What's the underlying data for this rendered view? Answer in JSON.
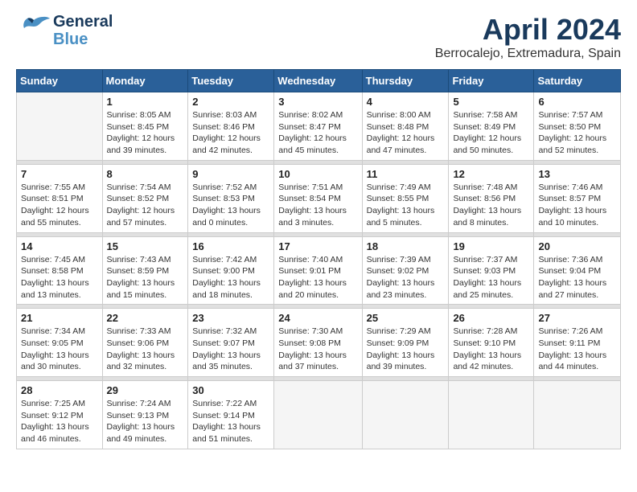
{
  "header": {
    "logo_general": "General",
    "logo_blue": "Blue",
    "month_title": "April 2024",
    "location": "Berrocalejo, Extremadura, Spain"
  },
  "columns": [
    "Sunday",
    "Monday",
    "Tuesday",
    "Wednesday",
    "Thursday",
    "Friday",
    "Saturday"
  ],
  "weeks": [
    {
      "days": [
        {
          "number": "",
          "empty": true
        },
        {
          "number": "1",
          "sunrise": "Sunrise: 8:05 AM",
          "sunset": "Sunset: 8:45 PM",
          "daylight": "Daylight: 12 hours and 39 minutes."
        },
        {
          "number": "2",
          "sunrise": "Sunrise: 8:03 AM",
          "sunset": "Sunset: 8:46 PM",
          "daylight": "Daylight: 12 hours and 42 minutes."
        },
        {
          "number": "3",
          "sunrise": "Sunrise: 8:02 AM",
          "sunset": "Sunset: 8:47 PM",
          "daylight": "Daylight: 12 hours and 45 minutes."
        },
        {
          "number": "4",
          "sunrise": "Sunrise: 8:00 AM",
          "sunset": "Sunset: 8:48 PM",
          "daylight": "Daylight: 12 hours and 47 minutes."
        },
        {
          "number": "5",
          "sunrise": "Sunrise: 7:58 AM",
          "sunset": "Sunset: 8:49 PM",
          "daylight": "Daylight: 12 hours and 50 minutes."
        },
        {
          "number": "6",
          "sunrise": "Sunrise: 7:57 AM",
          "sunset": "Sunset: 8:50 PM",
          "daylight": "Daylight: 12 hours and 52 minutes."
        }
      ]
    },
    {
      "days": [
        {
          "number": "7",
          "sunrise": "Sunrise: 7:55 AM",
          "sunset": "Sunset: 8:51 PM",
          "daylight": "Daylight: 12 hours and 55 minutes."
        },
        {
          "number": "8",
          "sunrise": "Sunrise: 7:54 AM",
          "sunset": "Sunset: 8:52 PM",
          "daylight": "Daylight: 12 hours and 57 minutes."
        },
        {
          "number": "9",
          "sunrise": "Sunrise: 7:52 AM",
          "sunset": "Sunset: 8:53 PM",
          "daylight": "Daylight: 13 hours and 0 minutes."
        },
        {
          "number": "10",
          "sunrise": "Sunrise: 7:51 AM",
          "sunset": "Sunset: 8:54 PM",
          "daylight": "Daylight: 13 hours and 3 minutes."
        },
        {
          "number": "11",
          "sunrise": "Sunrise: 7:49 AM",
          "sunset": "Sunset: 8:55 PM",
          "daylight": "Daylight: 13 hours and 5 minutes."
        },
        {
          "number": "12",
          "sunrise": "Sunrise: 7:48 AM",
          "sunset": "Sunset: 8:56 PM",
          "daylight": "Daylight: 13 hours and 8 minutes."
        },
        {
          "number": "13",
          "sunrise": "Sunrise: 7:46 AM",
          "sunset": "Sunset: 8:57 PM",
          "daylight": "Daylight: 13 hours and 10 minutes."
        }
      ]
    },
    {
      "days": [
        {
          "number": "14",
          "sunrise": "Sunrise: 7:45 AM",
          "sunset": "Sunset: 8:58 PM",
          "daylight": "Daylight: 13 hours and 13 minutes."
        },
        {
          "number": "15",
          "sunrise": "Sunrise: 7:43 AM",
          "sunset": "Sunset: 8:59 PM",
          "daylight": "Daylight: 13 hours and 15 minutes."
        },
        {
          "number": "16",
          "sunrise": "Sunrise: 7:42 AM",
          "sunset": "Sunset: 9:00 PM",
          "daylight": "Daylight: 13 hours and 18 minutes."
        },
        {
          "number": "17",
          "sunrise": "Sunrise: 7:40 AM",
          "sunset": "Sunset: 9:01 PM",
          "daylight": "Daylight: 13 hours and 20 minutes."
        },
        {
          "number": "18",
          "sunrise": "Sunrise: 7:39 AM",
          "sunset": "Sunset: 9:02 PM",
          "daylight": "Daylight: 13 hours and 23 minutes."
        },
        {
          "number": "19",
          "sunrise": "Sunrise: 7:37 AM",
          "sunset": "Sunset: 9:03 PM",
          "daylight": "Daylight: 13 hours and 25 minutes."
        },
        {
          "number": "20",
          "sunrise": "Sunrise: 7:36 AM",
          "sunset": "Sunset: 9:04 PM",
          "daylight": "Daylight: 13 hours and 27 minutes."
        }
      ]
    },
    {
      "days": [
        {
          "number": "21",
          "sunrise": "Sunrise: 7:34 AM",
          "sunset": "Sunset: 9:05 PM",
          "daylight": "Daylight: 13 hours and 30 minutes."
        },
        {
          "number": "22",
          "sunrise": "Sunrise: 7:33 AM",
          "sunset": "Sunset: 9:06 PM",
          "daylight": "Daylight: 13 hours and 32 minutes."
        },
        {
          "number": "23",
          "sunrise": "Sunrise: 7:32 AM",
          "sunset": "Sunset: 9:07 PM",
          "daylight": "Daylight: 13 hours and 35 minutes."
        },
        {
          "number": "24",
          "sunrise": "Sunrise: 7:30 AM",
          "sunset": "Sunset: 9:08 PM",
          "daylight": "Daylight: 13 hours and 37 minutes."
        },
        {
          "number": "25",
          "sunrise": "Sunrise: 7:29 AM",
          "sunset": "Sunset: 9:09 PM",
          "daylight": "Daylight: 13 hours and 39 minutes."
        },
        {
          "number": "26",
          "sunrise": "Sunrise: 7:28 AM",
          "sunset": "Sunset: 9:10 PM",
          "daylight": "Daylight: 13 hours and 42 minutes."
        },
        {
          "number": "27",
          "sunrise": "Sunrise: 7:26 AM",
          "sunset": "Sunset: 9:11 PM",
          "daylight": "Daylight: 13 hours and 44 minutes."
        }
      ]
    },
    {
      "days": [
        {
          "number": "28",
          "sunrise": "Sunrise: 7:25 AM",
          "sunset": "Sunset: 9:12 PM",
          "daylight": "Daylight: 13 hours and 46 minutes."
        },
        {
          "number": "29",
          "sunrise": "Sunrise: 7:24 AM",
          "sunset": "Sunset: 9:13 PM",
          "daylight": "Daylight: 13 hours and 49 minutes."
        },
        {
          "number": "30",
          "sunrise": "Sunrise: 7:22 AM",
          "sunset": "Sunset: 9:14 PM",
          "daylight": "Daylight: 13 hours and 51 minutes."
        },
        {
          "number": "",
          "empty": true
        },
        {
          "number": "",
          "empty": true
        },
        {
          "number": "",
          "empty": true
        },
        {
          "number": "",
          "empty": true
        }
      ]
    }
  ]
}
